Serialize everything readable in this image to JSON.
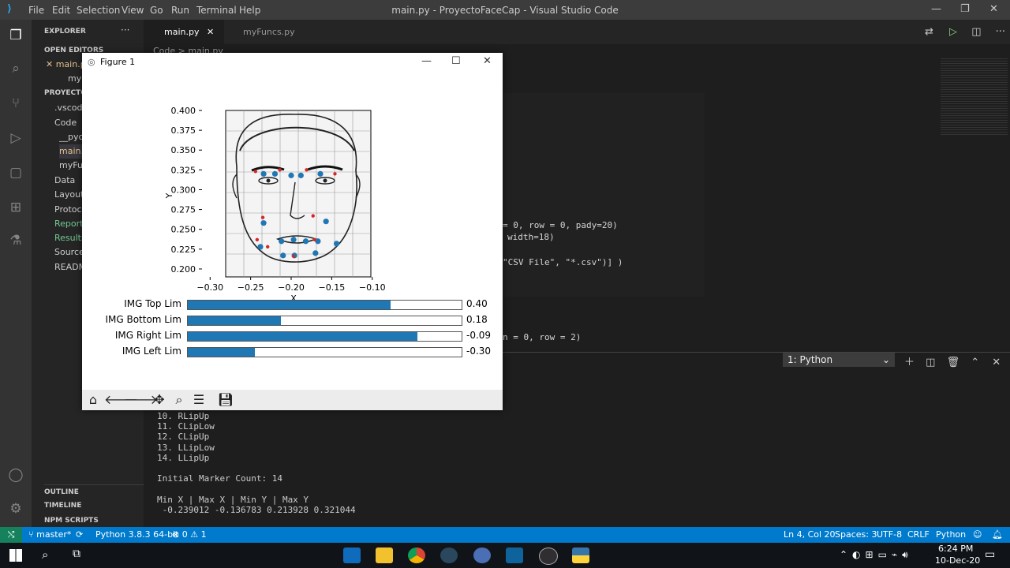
{
  "app": {
    "window_title": "main.py - ProyectoFaceCap - Visual Studio Code",
    "menu": [
      "File",
      "Edit",
      "Selection",
      "View",
      "Go",
      "Run",
      "Terminal",
      "Help"
    ]
  },
  "sidebar": {
    "header": "EXPLORER",
    "sections": {
      "open_editors": "OPEN EDITORS",
      "project": "PROYECTO",
      "outline": "OUTLINE",
      "timeline": "TIMELINE",
      "npm": "NPM SCRIPTS"
    },
    "open_editors": [
      "main.py",
      "myFuncs.py"
    ],
    "tree": [
      ".vscode",
      "Code",
      "__pycache__",
      "main.py",
      "myFuncs.py",
      "Data",
      "Layouts",
      "Protocols",
      "Reports",
      "Results",
      "Sources",
      "README"
    ]
  },
  "tabs": [
    "main.py",
    "myFuncs.py"
  ],
  "breadcrumb": [
    "Code",
    "main.py"
  ],
  "editor_lines": [
    "= 0, row = 0, pady=20)",
    "width=18)",
    "\"CSV File\", \"*.csv\")] )",
    "n = 0, row = 2)"
  ],
  "panel": {
    "terminal_select": "1: Python",
    "lines": [
      "10. RLipUp",
      "11. CLipLow",
      "12. CLipUp",
      "13. LLipLow",
      "14. LLipUp",
      "",
      "Initial Marker Count: 14",
      "",
      "Min X | Max X | Min Y | Max Y",
      " -0.239012 -0.136783 0.213928 0.321044"
    ]
  },
  "figure": {
    "title": "Figure 1",
    "xlabel": "X",
    "ylabel": "Y",
    "sliders": [
      {
        "label": "IMG Top Lim",
        "value_text": "0.40",
        "fill": 0.74
      },
      {
        "label": "IMG Bottom Lim",
        "value_text": "0.18",
        "fill": 0.34
      },
      {
        "label": "IMG Right Lim",
        "value_text": "-0.09",
        "fill": 0.84
      },
      {
        "label": "IMG Left Lim",
        "value_text": "-0.30",
        "fill": 0.245
      }
    ],
    "toolbar_icons": [
      "home-icon",
      "back-icon",
      "forward-icon",
      "pan-icon",
      "zoom-icon",
      "configure-icon",
      "save-icon"
    ]
  },
  "chart_data": {
    "type": "scatter",
    "xlabel": "X",
    "ylabel": "Y",
    "xlim": [
      -0.31,
      -0.09
    ],
    "ylim": [
      0.19,
      0.4
    ],
    "xticks": [
      -0.3,
      -0.25,
      -0.2,
      -0.15,
      -0.1
    ],
    "yticks": [
      0.2,
      0.225,
      0.25,
      0.275,
      0.3,
      0.325,
      0.35,
      0.375,
      0.4
    ],
    "xtick_labels": [
      "−0.30",
      "−0.25",
      "−0.20",
      "−0.15",
      "−0.10"
    ],
    "ytick_labels": [
      "0.200",
      "0.225",
      "0.250",
      "0.275",
      "0.300",
      "0.325",
      "0.350",
      "0.375",
      "0.400"
    ],
    "series": [
      {
        "color": "#1f77b4",
        "x": [
          -0.234,
          -0.22,
          -0.2,
          -0.188,
          -0.164,
          -0.234,
          -0.157,
          -0.238,
          -0.212,
          -0.197,
          -0.182,
          -0.167,
          -0.144,
          -0.21,
          -0.196,
          -0.17
        ],
        "y": [
          0.32,
          0.32,
          0.318,
          0.318,
          0.32,
          0.258,
          0.26,
          0.228,
          0.235,
          0.237,
          0.235,
          0.235,
          0.232,
          0.217,
          0.217,
          0.22
        ]
      },
      {
        "color": "#d62728",
        "x": [
          -0.244,
          -0.214,
          -0.181,
          -0.146,
          -0.235,
          -0.173,
          -0.242,
          -0.229,
          -0.197,
          -0.171
        ],
        "y": [
          0.323,
          0.325,
          0.325,
          0.32,
          0.265,
          0.267,
          0.237,
          0.228,
          0.216,
          0.237
        ]
      }
    ]
  },
  "status": {
    "branch": "master*",
    "interpreter": "Python 3.8.3 64-bit",
    "problems": "⊗ 0 ⚠ 1",
    "position": "Ln 4, Col 20",
    "spaces": "Spaces: 3",
    "encoding": "UTF-8",
    "eol": "CRLF",
    "language": "Python"
  },
  "taskbar": {
    "time": "6:24 PM",
    "date": "10-Dec-20"
  },
  "colors": {
    "statusbar": "#007acc",
    "scatter_blue": "#1f77b4",
    "scatter_red": "#d62728"
  }
}
